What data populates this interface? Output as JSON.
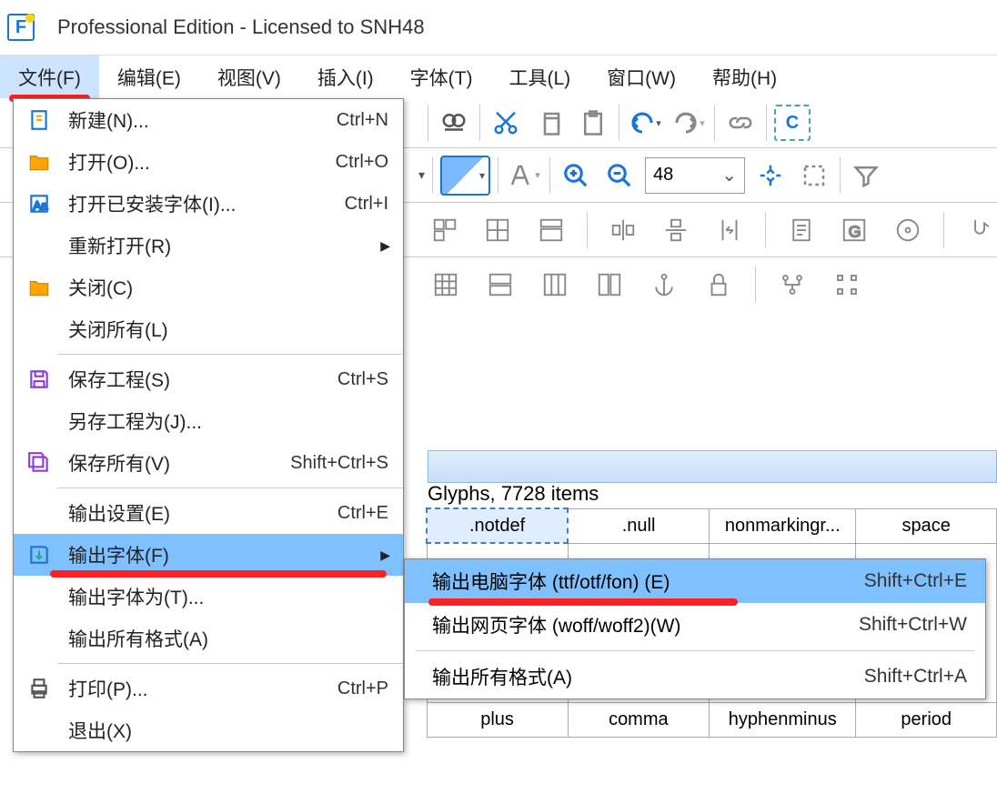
{
  "title": "Professional Edition - Licensed to SNH48",
  "menubar": [
    "文件(F)",
    "编辑(E)",
    "视图(V)",
    "插入(I)",
    "字体(T)",
    "工具(L)",
    "窗口(W)",
    "帮助(H)"
  ],
  "file_menu": [
    {
      "label": "新建(N)...",
      "shortcut": "Ctrl+N",
      "icon": "new"
    },
    {
      "label": "打开(O)...",
      "shortcut": "Ctrl+O",
      "icon": "open"
    },
    {
      "label": "打开已安装字体(I)...",
      "shortcut": "Ctrl+I",
      "icon": "installed"
    },
    {
      "label": "重新打开(R)",
      "shortcut": "",
      "arrow": true
    },
    {
      "label": "关闭(C)",
      "shortcut": "",
      "icon": "close"
    },
    {
      "label": "关闭所有(L)",
      "shortcut": ""
    },
    {
      "sep": true
    },
    {
      "label": "保存工程(S)",
      "shortcut": "Ctrl+S",
      "icon": "save"
    },
    {
      "label": "另存工程为(J)...",
      "shortcut": ""
    },
    {
      "label": "保存所有(V)",
      "shortcut": "Shift+Ctrl+S",
      "icon": "saveall"
    },
    {
      "sep": true
    },
    {
      "label": "输出设置(E)",
      "shortcut": "Ctrl+E"
    },
    {
      "label": "输出字体(F)",
      "shortcut": "",
      "arrow": true,
      "selected": true,
      "icon": "export",
      "redline": true
    },
    {
      "label": "输出字体为(T)...",
      "shortcut": ""
    },
    {
      "label": "输出所有格式(A)",
      "shortcut": ""
    },
    {
      "sep": true
    },
    {
      "label": "打印(P)...",
      "shortcut": "Ctrl+P",
      "icon": "print"
    },
    {
      "label": "退出(X)",
      "shortcut": ""
    }
  ],
  "submenu": [
    {
      "label": "输出电脑字体 (ttf/otf/fon) (E)",
      "shortcut": "Shift+Ctrl+E",
      "selected": true,
      "redline": true
    },
    {
      "label": "输出网页字体 (woff/woff2)(W)",
      "shortcut": "Shift+Ctrl+W"
    },
    {
      "sep": true
    },
    {
      "label": "输出所有格式(A)",
      "shortcut": "Shift+Ctrl+A"
    }
  ],
  "panel_title": "Glyphs, 7728 items",
  "fontsize": "48",
  "glyphs_row1": [
    ".notdef",
    ".null",
    "nonmarkingr...",
    "space"
  ],
  "glyphs_row2": [
    "plus",
    "comma",
    "hyphenminus",
    "period"
  ]
}
